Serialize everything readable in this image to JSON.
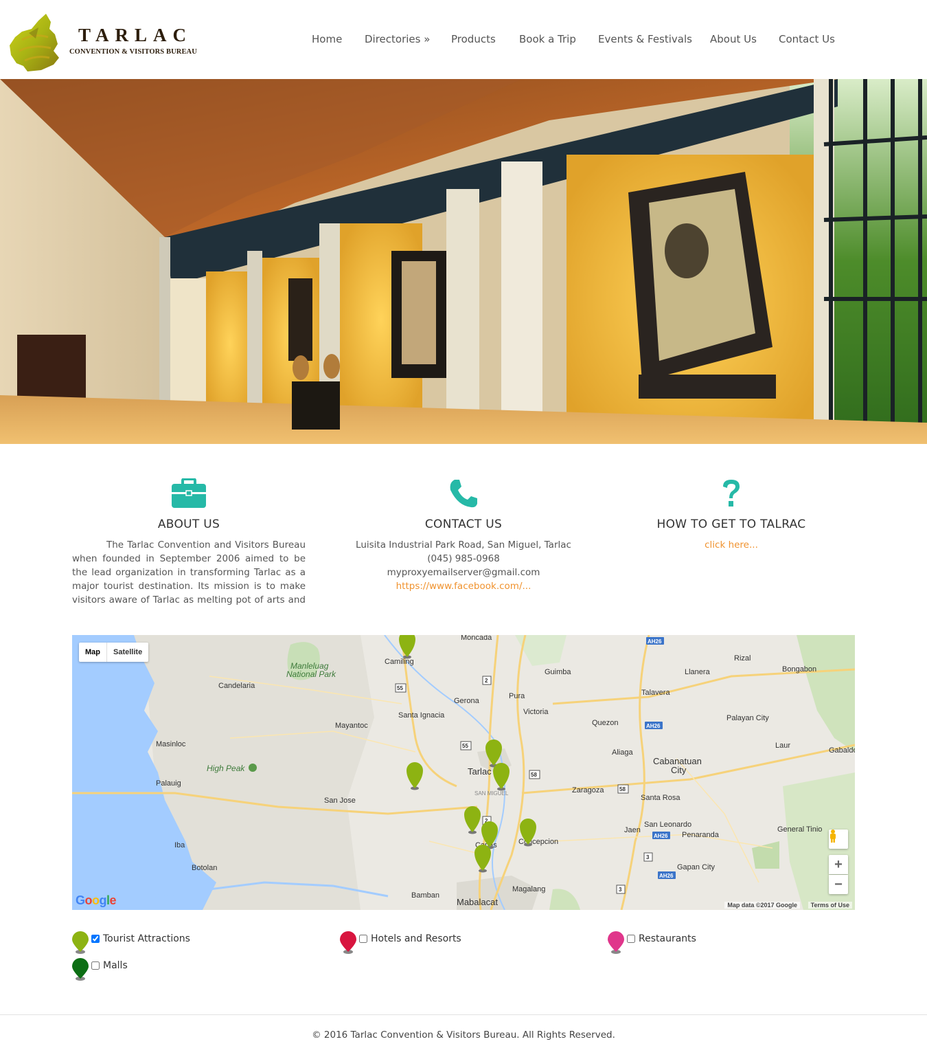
{
  "brand": {
    "title": "TARLAC",
    "subtitle": "CONVENTION & VISITORS BUREAU"
  },
  "nav": {
    "items": [
      {
        "label": "Home"
      },
      {
        "label": "Directories »"
      },
      {
        "label": "Products"
      },
      {
        "label": "Book a Trip"
      },
      {
        "label": "Events & Festivals"
      },
      {
        "label": "About Us"
      },
      {
        "label": "Contact Us"
      }
    ]
  },
  "hero": {
    "icon": "museum-hall-photo"
  },
  "about": {
    "icon": "briefcase-icon",
    "title": "ABOUT US",
    "text": "The Tarlac Convention and Visitors Bureau when founded in September 2006 aimed to be the lead organization in transforming Tarlac as a major tourist destination. Its mission is to make visitors aware of Tarlac as melting pot of arts and culture,"
  },
  "contact": {
    "icon": "phone-icon",
    "title": "CONTACT US",
    "address": "Luisita Industrial Park Road, San Miguel, Tarlac",
    "phone": "(045) 985-0968",
    "email": "myproxyemailserver@gmail.com",
    "facebook": "https://www.facebook.com/..."
  },
  "howto": {
    "icon": "question-icon",
    "title": "HOW TO GET TO TALRAC",
    "link": "click here..."
  },
  "map": {
    "type_map": "Map",
    "type_satellite": "Satellite",
    "zoom_in": "+",
    "zoom_out": "−",
    "attribution": "Map data ©2017 Google",
    "terms": "Terms of Use",
    "google": "Google",
    "places": {
      "moncada": "Moncada",
      "camiling": "Camiling",
      "guimba": "Guimba",
      "llanera": "Llanera",
      "rizal": "Rizal",
      "bongabon": "Bongabon",
      "manleluag1": "Manleluag",
      "manleluag2": "National Park",
      "candelaria": "Candelaria",
      "pura": "Pura",
      "gerona": "Gerona",
      "talavera": "Talavera",
      "victoria": "Victoria",
      "santa_ignacia": "Santa Ignacia",
      "mayantoc": "Mayantoc",
      "quezon": "Quezon",
      "palayan": "Palayan City",
      "masinloc": "Masinloc",
      "laur": "Laur",
      "aliaga": "Aliaga",
      "gabaldon": "Gabaldo",
      "high_peak": "High Peak",
      "tarlac_city": "Tarlac City",
      "cabanatuan1": "Cabanatuan",
      "cabanatuan2": "City",
      "palauig": "Palauig",
      "san_miguel": "SAN MIGUEL",
      "zaragoza": "Zaragoza",
      "santa_rosa": "Santa Rosa",
      "san_jose": "San Jose",
      "san_leonardo": "San Leonardo",
      "jaen": "Jaen",
      "penaranda": "Penaranda",
      "general_tinio": "General Tinio",
      "iba": "Iba",
      "capas": "Capas",
      "concepcion": "Concepcion",
      "gapan": "Gapan City",
      "botolan": "Botolan",
      "magalang": "Magalang",
      "bamban": "Bamban",
      "mabalacat": "Mabalacat"
    },
    "shields": {
      "ah26": "AH26",
      "r2": "2",
      "r55": "55",
      "r58": "58",
      "r3": "3"
    }
  },
  "legend": {
    "tourist": {
      "label": "Tourist Attractions",
      "color": "#8db312",
      "checked": true
    },
    "hotels": {
      "label": "Hotels and Resorts",
      "color": "#d8153f",
      "checked": false
    },
    "restaurants": {
      "label": "Restaurants",
      "color": "#e0368b",
      "checked": false
    },
    "malls": {
      "label": "Malls",
      "color": "#0c6e14",
      "checked": false
    }
  },
  "footer": {
    "text": "© 2016 Tarlac Convention & Visitors Bureau. All Rights Reserved."
  },
  "colors": {
    "accent_teal": "#26b9a7",
    "link_orange": "#f0922e",
    "logo_green": "#a8b813"
  }
}
